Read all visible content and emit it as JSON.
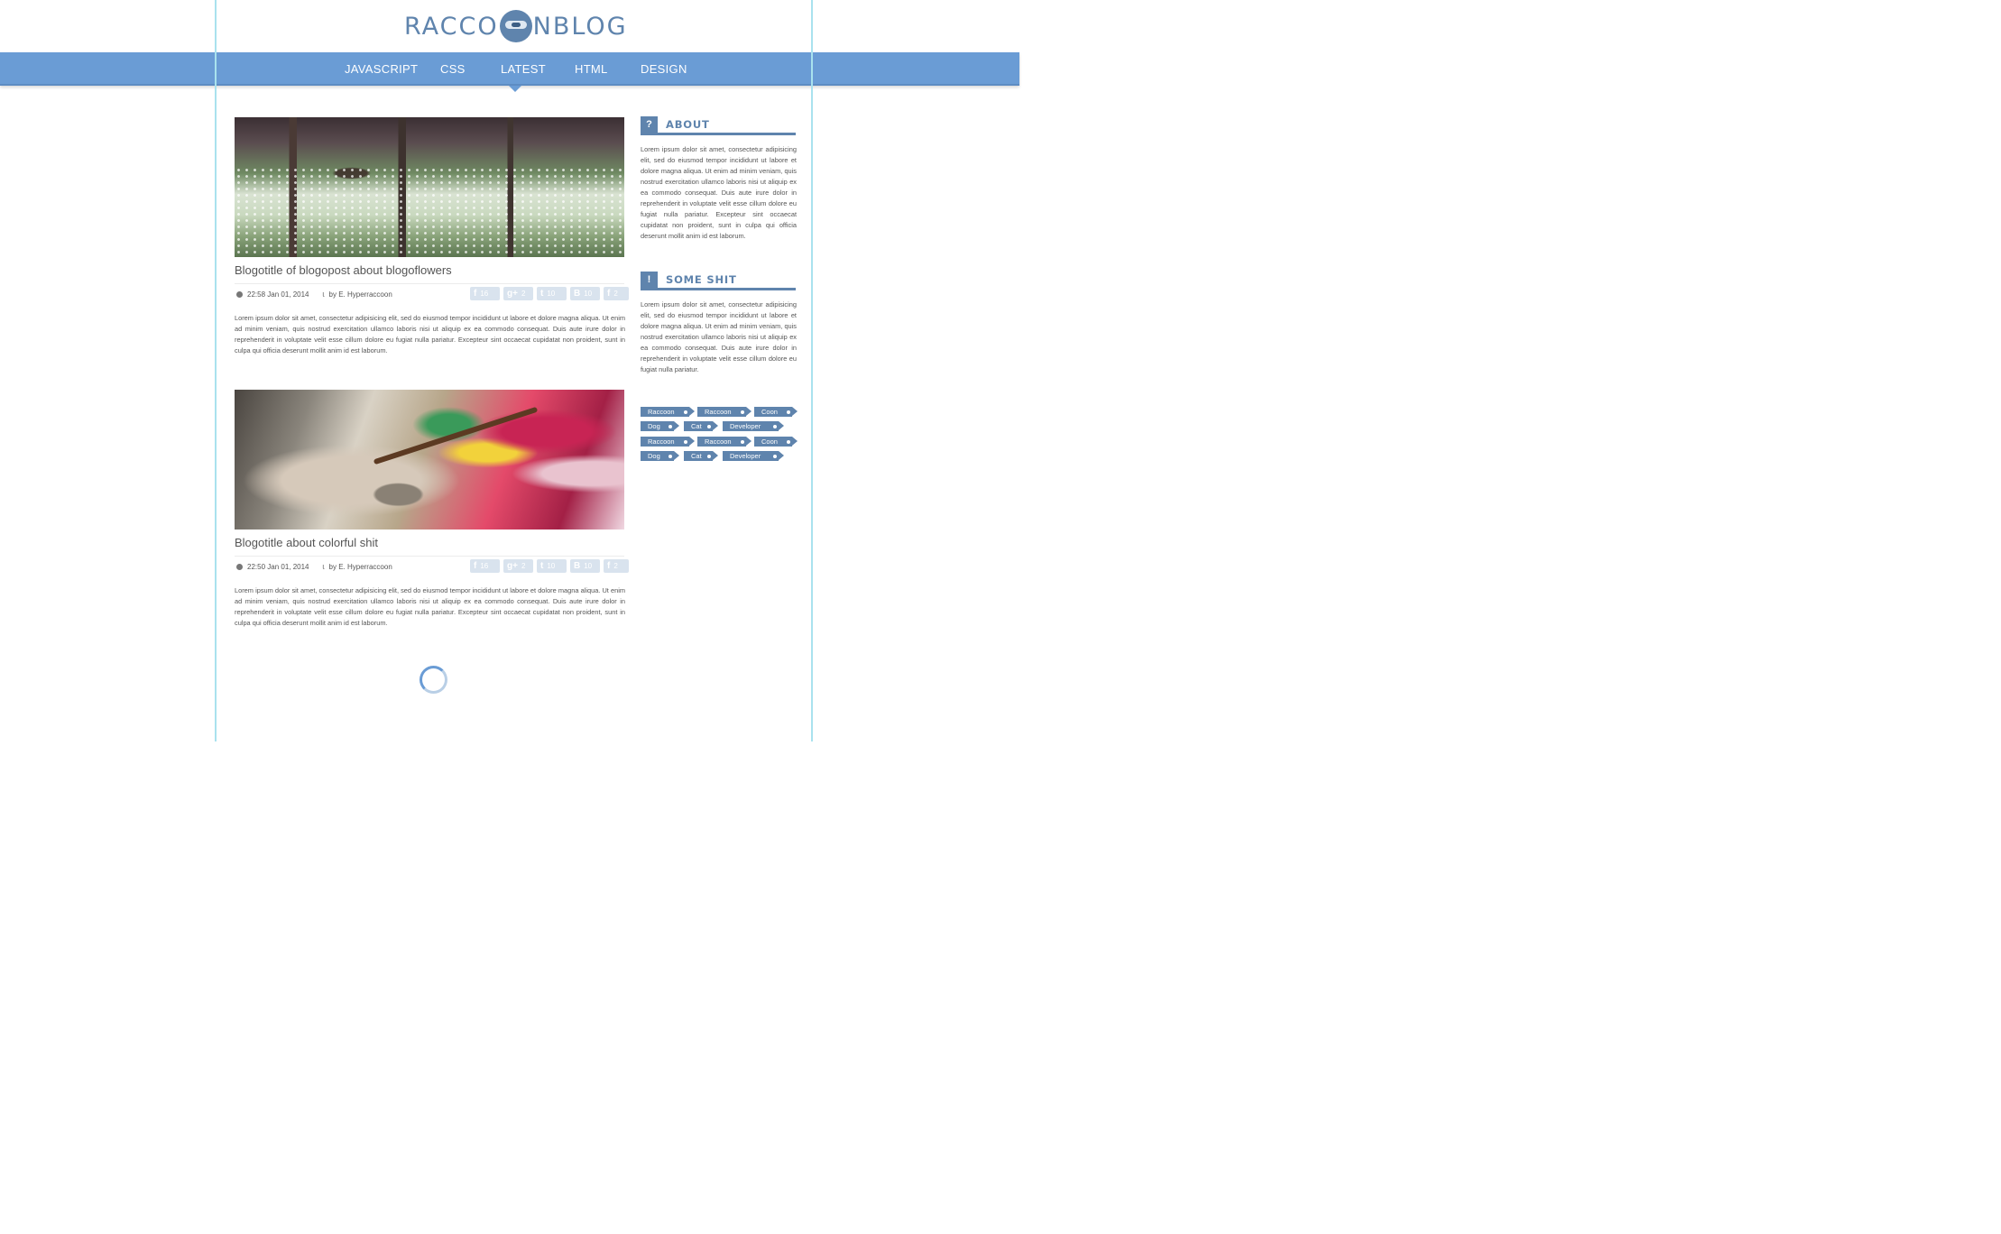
{
  "logo": {
    "left": "RACCO",
    "right": "NBLOG"
  },
  "nav": {
    "items": [
      "JAVASCRIPT",
      "CSS",
      "LATEST",
      "HTML",
      "DESIGN"
    ],
    "active": "LATEST"
  },
  "posts": [
    {
      "title": "Blogotitle of blogopost about blogoflowers",
      "time": "22:58 Jan 01, 2014",
      "author": "by E. Hyperraccoon",
      "shares": {
        "facebook": "16",
        "googleplus": "2",
        "twitter": "10",
        "blogger": "10",
        "facebook_alt": "2"
      },
      "body": "Lorem ipsum dolor sit amet, consectetur adipisicing elit, sed do eiusmod tempor incididunt ut labore et dolore magna aliqua. Ut enim ad minim veniam, quis nostrud exercitation ullamco laboris nisi ut aliquip ex ea commodo consequat. Duis aute irure dolor in reprehenderit in voluptate velit esse cillum dolore eu fugiat nulla pariatur. Excepteur sint occaecat cupidatat non proident, sunt in culpa qui officia deserunt mollit anim id est laborum."
    },
    {
      "title": "Blogotitle about colorful shit",
      "time": "22:50 Jan 01, 2014",
      "author": "by E. Hyperraccoon",
      "shares": {
        "facebook": "16",
        "googleplus": "2",
        "twitter": "10",
        "blogger": "10",
        "facebook_alt": "2"
      },
      "body": "Lorem ipsum dolor sit amet, consectetur adipisicing elit, sed do eiusmod tempor incididunt ut labore et dolore magna aliqua. Ut enim ad minim veniam, quis nostrud exercitation ullamco laboris nisi ut aliquip ex ea commodo consequat. Duis aute irure dolor in reprehenderit in voluptate velit esse cillum dolore eu fugiat nulla pariatur. Excepteur sint occaecat cupidatat non proident, sunt in culpa qui officia deserunt mollit anim id est laborum."
    }
  ],
  "sidebar": {
    "about": {
      "icon": "?",
      "title": "ABOUT",
      "text": "Lorem ipsum dolor sit amet, consectetur adipisicing elit, sed do eiusmod tempor incididunt ut labore et dolore magna aliqua. Ut enim ad minim veniam, quis nostrud exercitation ullamco laboris nisi ut aliquip ex ea commodo consequat. Duis aute irure dolor in reprehenderit in voluptate velit esse cillum dolore eu fugiat nulla pariatur. Excepteur sint occaecat cupidatat non proident, sunt in culpa qui officia deserunt mollit anim id est laborum."
    },
    "some_shit": {
      "icon": "!",
      "title": "SOME SHIT",
      "text": "Lorem ipsum dolor sit amet, consectetur adipisicing elit, sed do eiusmod tempor incididunt ut labore et dolore magna aliqua. Ut enim ad minim veniam, quis nostrud exercitation ullamco laboris nisi ut aliquip ex ea commodo consequat. Duis aute irure dolor in reprehenderit in voluptate velit esse cillum dolore eu fugiat nulla pariatur."
    },
    "tags": [
      "Raccoon",
      "Raccoon",
      "Coon",
      "Dog",
      "Cat",
      "Developer",
      "Raccoon",
      "Raccoon",
      "Coon",
      "Dog",
      "Cat",
      "Developer"
    ]
  },
  "colors": {
    "accent": "#6a9cd5",
    "brand": "#5f84ad",
    "guide": "#a9e2ee",
    "share_bg": "#d9e3ee"
  }
}
